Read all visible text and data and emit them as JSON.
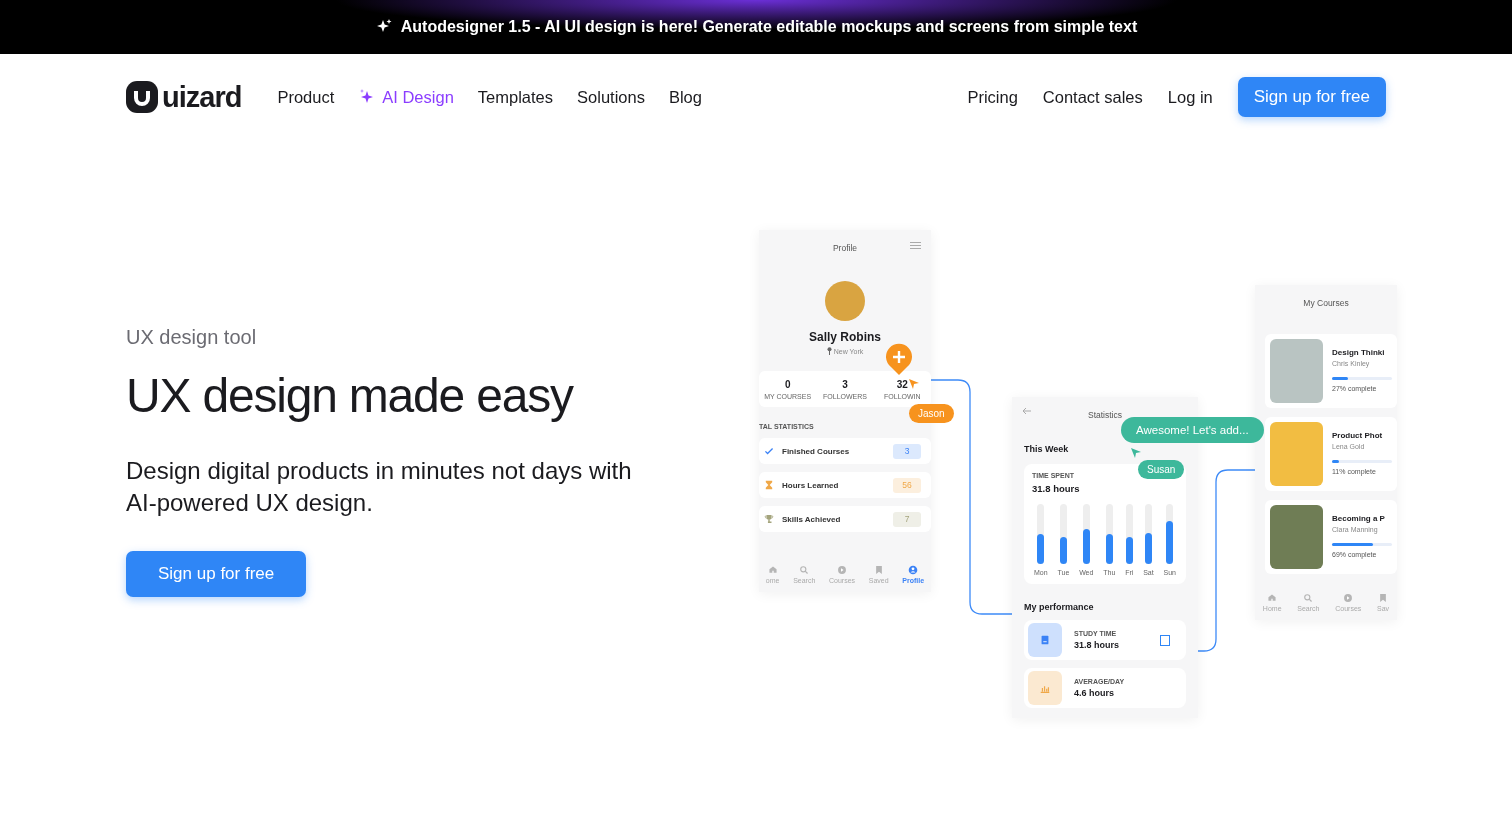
{
  "banner": {
    "text": "Autodesigner 1.5 - AI UI design is here! Generate editable mockups and screens from simple text"
  },
  "nav": {
    "logo": "uizard",
    "links": [
      {
        "label": "Product",
        "kind": "plain"
      },
      {
        "label": "AI Design",
        "kind": "ai"
      },
      {
        "label": "Templates",
        "kind": "plain"
      },
      {
        "label": "Solutions",
        "kind": "plain"
      },
      {
        "label": "Blog",
        "kind": "plain"
      }
    ],
    "right_links": [
      "Pricing",
      "Contact sales",
      "Log in"
    ],
    "signup_button": "Sign up for free"
  },
  "hero": {
    "eyebrow": "UX design tool",
    "title": "UX design made easy",
    "description": "Design digital products in minutes not days with AI-powered UX design.",
    "button": "Sign up for free"
  },
  "mockup": {
    "profile_screen": {
      "title": "Profile",
      "name": "Sally Robins",
      "location": "New York",
      "stats": [
        {
          "value": "0",
          "label": "MY COURSES"
        },
        {
          "value": "3",
          "label": "FOLLOWERS"
        },
        {
          "value": "32",
          "label": "FOLLOWIN"
        }
      ],
      "section_title": "TAL STATISTICS",
      "rows": [
        {
          "kind": "check",
          "label": "Finished Courses",
          "value": "3",
          "color": "#3b82f6"
        },
        {
          "kind": "hourglass",
          "label": "Hours Learned",
          "value": "56",
          "color": "#f0a848"
        },
        {
          "kind": "trophy",
          "label": "Skills Achieved",
          "value": "7",
          "color": "#a4a47c"
        }
      ],
      "tabs": [
        {
          "kind": "home",
          "label": "ome",
          "selected": false
        },
        {
          "kind": "search",
          "label": "Search",
          "selected": false
        },
        {
          "kind": "play",
          "label": "Courses",
          "selected": false
        },
        {
          "kind": "bookmark",
          "label": "Saved",
          "selected": false
        },
        {
          "kind": "person",
          "label": "Profile",
          "selected": true
        }
      ]
    },
    "statistics_screen": {
      "title": "Statistics",
      "week_title": "This Week",
      "card_label": "TIME SPENT",
      "card_value": "31.8 hours",
      "days": [
        {
          "label": "Mon",
          "level": 0.5
        },
        {
          "label": "Tue",
          "level": 0.45
        },
        {
          "label": "Wed",
          "level": 0.58
        },
        {
          "label": "Thu",
          "level": 0.5
        },
        {
          "label": "Fri",
          "level": 0.45
        },
        {
          "label": "Sat",
          "level": 0.52
        },
        {
          "label": "Sun",
          "level": 0.72
        }
      ],
      "performance_title": "My performance",
      "performance": [
        {
          "kind": "book",
          "label": "STUDY TIME",
          "value": "31.8 hours",
          "color": "#3b82f6"
        },
        {
          "kind": "chart",
          "label": "AVERAGE/DAY",
          "value": "4.6 hours",
          "color": "#f0a848"
        }
      ]
    },
    "courses_screen": {
      "title": "My Courses",
      "courses": [
        {
          "title": "Design Thinki",
          "author": "Chris Kinley",
          "level": 0.27,
          "progress": "27% complete",
          "color": "#b9c4c2"
        },
        {
          "title": "Product Phot",
          "author": "Lena Gold",
          "level": 0.11,
          "progress": "11% complete",
          "color": "#f2bd42"
        },
        {
          "title": "Becoming a P",
          "author": "Clara Manning",
          "level": 0.69,
          "progress": "69% complete",
          "color": "#6f7d55"
        }
      ],
      "tabs": [
        {
          "kind": "home",
          "label": "Home",
          "selected": false
        },
        {
          "kind": "search",
          "label": "Search",
          "selected": false
        },
        {
          "kind": "play",
          "label": "Courses",
          "selected": false
        },
        {
          "kind": "bookmark",
          "label": "Sav",
          "selected": false
        }
      ]
    },
    "collaborators": [
      {
        "name": "Jason",
        "color": "#f7931e"
      },
      {
        "name": "Susan",
        "color": "#3db89b"
      }
    ],
    "comment": "Awesome! Let's add..."
  }
}
